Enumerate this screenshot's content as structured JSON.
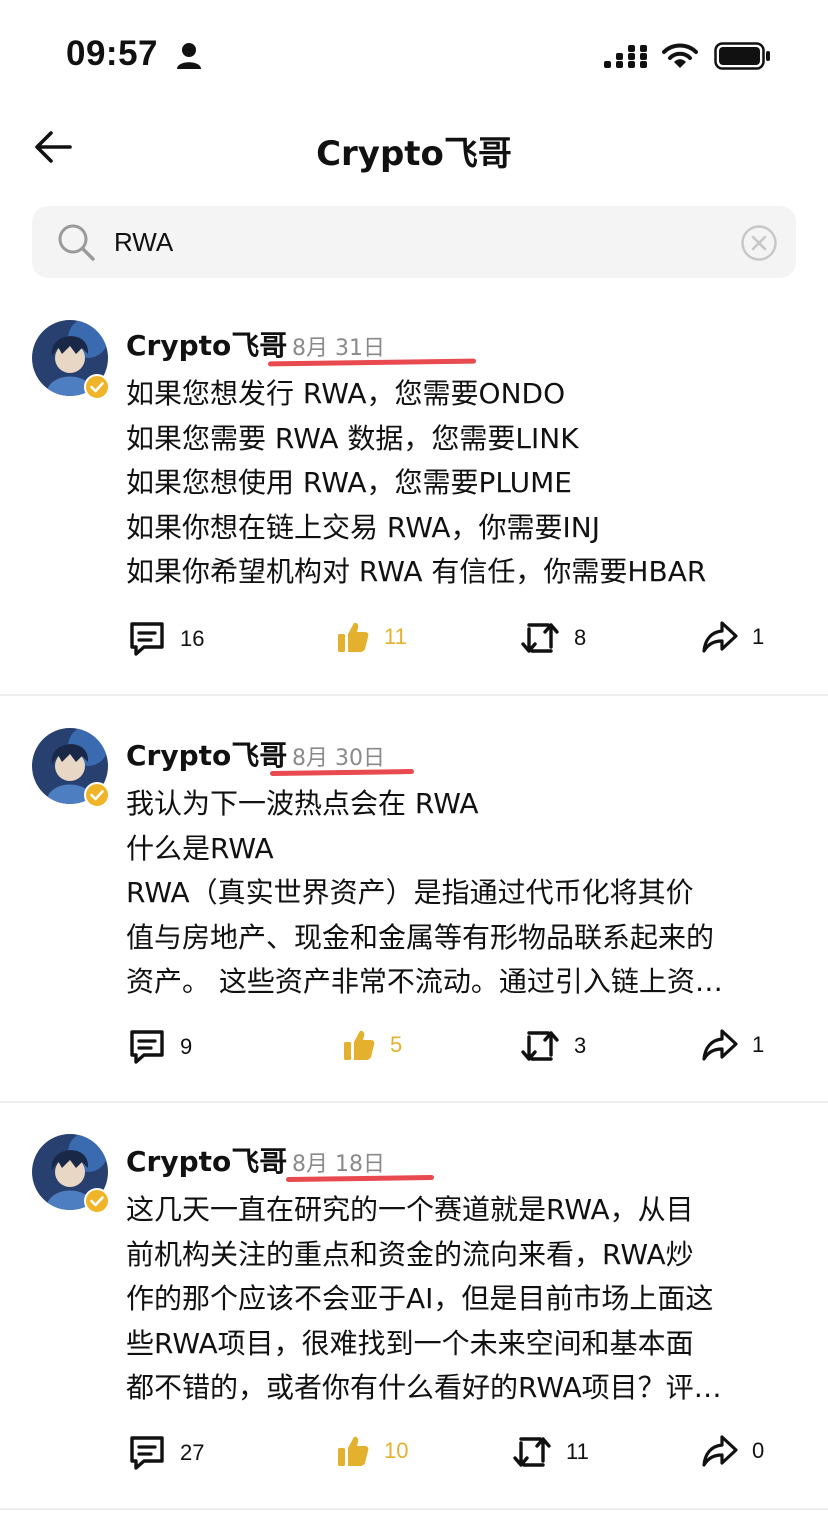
{
  "status_bar": {
    "time": "09:57"
  },
  "nav": {
    "title": "Crypto飞哥"
  },
  "search": {
    "value": "RWA"
  },
  "colors": {
    "like": "#e3b12d",
    "highlight_underline": "#e84a4f",
    "date": "#8a8a8a"
  },
  "posts": [
    {
      "author": "Crypto飞哥",
      "date": "8月 31日",
      "lines": [
        "如果您想发行 RWA，您需要ONDO",
        "如果您需要 RWA 数据，您需要LINK",
        "如果您想使用 RWA，您需要PLUME",
        "如果你想在链上交易 RWA，你需要INJ",
        "如果你希望机构对 RWA 有信任，你需要HBAR"
      ],
      "comments": "16",
      "likes": "11",
      "reposts": "8",
      "shares": "1"
    },
    {
      "author": "Crypto飞哥",
      "date": "8月 30日",
      "lines": [
        "我认为下一波热点会在 RWA",
        "什么是RWA",
        "RWA（真实世界资产）是指通过代币化将其价",
        "值与房地产、现金和金属等有形物品联系起来的",
        "资产。 这些资产非常不流动。通过引入链上资…"
      ],
      "comments": "9",
      "likes": "5",
      "reposts": "3",
      "shares": "1"
    },
    {
      "author": "Crypto飞哥",
      "date": "8月 18日",
      "lines": [
        "这几天一直在研究的一个赛道就是RWA，从目",
        "前机构关注的重点和资金的流向来看，RWA炒",
        "作的那个应该不会亚于AI，但是目前市场上面这",
        "些RWA项目，很难找到一个未来空间和基本面",
        "都不错的，或者你有什么看好的RWA项目？评…"
      ],
      "comments": "27",
      "likes": "10",
      "reposts": "11",
      "shares": "0"
    }
  ]
}
